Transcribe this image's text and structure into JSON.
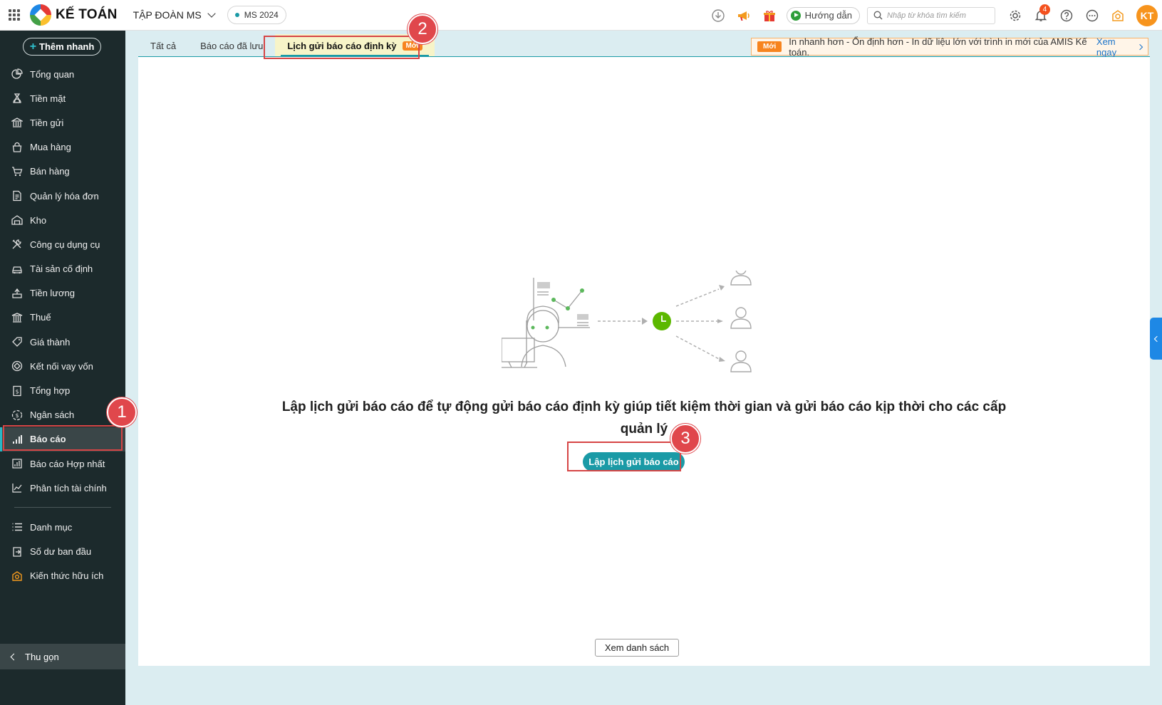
{
  "app": {
    "brand": "KẾ TOÁN",
    "company": "TẬP ĐOÀN MS",
    "database": "MS 2024",
    "guide_label": "Hướng dẫn",
    "search_placeholder": "Nhập từ khóa tìm kiếm",
    "notification_count": "4",
    "avatar_initials": "KT"
  },
  "sidebar": {
    "quick_add": "Thêm nhanh",
    "items": [
      {
        "label": "Tổng quan",
        "icon": "pie-chart-icon"
      },
      {
        "label": "Tiền mặt",
        "icon": "money-bag-icon"
      },
      {
        "label": "Tiền gửi",
        "icon": "bank-icon"
      },
      {
        "label": "Mua hàng",
        "icon": "shopping-bag-icon"
      },
      {
        "label": "Bán hàng",
        "icon": "cart-icon"
      },
      {
        "label": "Quản lý hóa đơn",
        "icon": "invoice-icon"
      },
      {
        "label": "Kho",
        "icon": "warehouse-icon"
      },
      {
        "label": "Công cụ dụng cụ",
        "icon": "tools-icon"
      },
      {
        "label": "Tài sản cố định",
        "icon": "car-icon"
      },
      {
        "label": "Tiền lương",
        "icon": "salary-icon"
      },
      {
        "label": "Thuế",
        "icon": "tax-building-icon"
      },
      {
        "label": "Giá thành",
        "icon": "price-tag-icon"
      },
      {
        "label": "Kết nối vay vốn",
        "icon": "loan-link-icon"
      },
      {
        "label": "Tổng hợp",
        "icon": "ledger-icon"
      },
      {
        "label": "Ngân sách",
        "icon": "budget-icon"
      },
      {
        "label": "Báo cáo",
        "icon": "bar-chart-icon"
      },
      {
        "label": "Báo cáo Hợp nhất",
        "icon": "consolidated-report-icon"
      },
      {
        "label": "Phân tích tài chính",
        "icon": "trend-chart-icon"
      }
    ],
    "items_bottom": [
      {
        "label": "Danh mục",
        "icon": "list-icon"
      },
      {
        "label": "Số dư ban đầu",
        "icon": "opening-balance-icon"
      },
      {
        "label": "Kiến thức hữu ích",
        "icon": "knowledge-icon"
      }
    ],
    "collapse_label": "Thu gọn"
  },
  "tabs": [
    {
      "label": "Tất cả"
    },
    {
      "label": "Báo cáo đã lưu"
    },
    {
      "label": "Lịch gửi báo cáo định kỳ",
      "tag": "Mới"
    }
  ],
  "notice": {
    "tag": "Mới",
    "text": "In nhanh hơn - Ổn định hơn - In dữ liệu lớn với trình in mới của AMIS Kế toán.",
    "link": "Xem ngay"
  },
  "empty_state": {
    "message": "Lập lịch gửi báo cáo để tự động gửi báo cáo định kỳ giúp tiết kiệm thời gian và gửi báo cáo kịp thời cho các cấp quản lý",
    "primary_button": "Lập lịch gửi báo cáo",
    "secondary_button": "Xem danh sách"
  },
  "annotations": [
    "1",
    "2",
    "3"
  ],
  "colors": {
    "accent": "#1a9aa6",
    "sidebar_bg": "#1c2a2c",
    "annotation": "#e0474c",
    "new_tag": "#f7841e"
  }
}
